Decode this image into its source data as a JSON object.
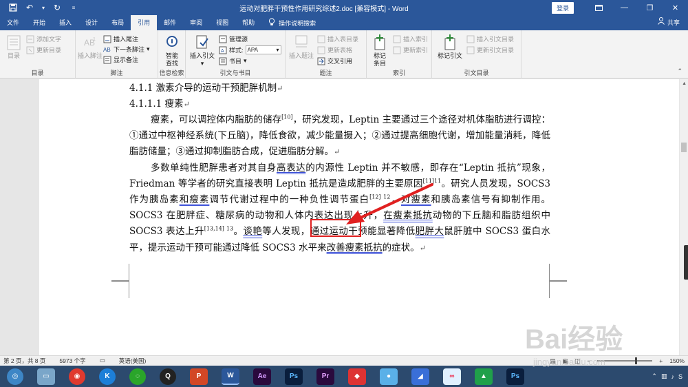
{
  "titlebar": {
    "title": "运动对肥胖干预性作用研究综述2.doc [兼容模式] - Word",
    "login": "登录"
  },
  "tabs": [
    "文件",
    "开始",
    "插入",
    "设计",
    "布局",
    "引用",
    "邮件",
    "审阅",
    "视图",
    "帮助"
  ],
  "tell_me": "操作说明搜索",
  "share": "共享",
  "ribbon": {
    "toc": {
      "label": "目录",
      "add_text": "添加文字",
      "update": "更新目录",
      "group": "目录"
    },
    "footnote": {
      "insert": "插入脚注",
      "endnote": "插入尾注",
      "next": "下一条脚注",
      "show": "显示备注",
      "group": "脚注"
    },
    "research": {
      "smart": "智能\n查找",
      "group": "信息检索"
    },
    "citation": {
      "insert": "插入引文",
      "manage": "管理源",
      "style_label": "样式:",
      "style_value": "APA",
      "biblio": "书目",
      "group": "引文与书目"
    },
    "caption": {
      "insert": "插入题注",
      "table": "插入表目录",
      "update": "更新表格",
      "cross": "交叉引用",
      "group": "题注"
    },
    "index": {
      "mark": "标记\n条目",
      "insert": "插入索引",
      "update": "更新索引",
      "group": "索引"
    },
    "toa": {
      "mark": "标记引文",
      "insert": "插入引文目录",
      "update": "更新引文目录",
      "group": "引文目录"
    }
  },
  "document": {
    "h1": "4.1.1  激素介导的运动干预肥胖机制",
    "h2": "4.1.1.1  瘦素",
    "p1_a": "瘦素，可以调控体内脂肪的储存",
    "p1_ref": "[10]",
    "p1_b": "，研究发现，Leptin 主要通过三个途径对机体脂肪进行调控：①通过中枢神经系统(下丘脑)，降低食欲，减少能量摄入；②通过提高细胞代谢，增加能量消耗，降低脂肪储量；③通过抑制脂肪合成，促进脂肪分解。",
    "p2_a": "多数单纯性肥胖患者对其自身",
    "p2_u1": "高表达",
    "p2_b": "的内源性 Leptin 并不敏感，即存在“Leptin 抵抗”现象，Friedman 等学者的研究直接表明 Leptin 抵抗是造成肥胖的主要原因",
    "p2_ref1": "[11]",
    "p2_ref1b": "11",
    "p2_c": "。研究人员发现，SOCS3 作为胰岛素",
    "p2_u2": "和瘦素",
    "p2_d": "调节代谢过程中的一种负性调节蛋白",
    "p2_ref2": "[12]",
    "p2_ref2b": " 12",
    "p2_e": "，",
    "p2_u3": "对瘦素",
    "p2_f": "和胰岛素信号有抑制作用。SOCS3 在肥胖症、糖尿病的动物和人体内表达出现上升，",
    "p2_u4": "在瘦素抵抗",
    "p2_g": "动物的下丘脑和脂肪组织中 SOCS3 表达上升",
    "p2_ref3": "[13,14]",
    "p2_ref3b": " 13",
    "p2_h": "。",
    "p2_u5": "谈艳",
    "p2_i": "等人发现，通过运动干预能显著降低",
    "p2_u6": "肥胖大",
    "p2_j": "鼠肝脏中 SOCS3 蛋白水平，提示运动干预可能通过降低 SOCS3 水平来",
    "p2_u7": "改善瘦素抵抗",
    "p2_k": "的症状。",
    "para_mark": "↵"
  },
  "statusbar": {
    "page": "第 2 页，共 8 页",
    "words": "5973 个字",
    "lang": "英语(美国)",
    "zoom": "150%",
    "zoom_minus": "−",
    "zoom_plus": "+"
  },
  "watermark": {
    "text": "Bai经验",
    "url": "jingyan.baidu.com"
  },
  "colors": {
    "word_blue": "#2b579a",
    "annotation_red": "#e02020",
    "taskbar": "#2c4a6e"
  }
}
